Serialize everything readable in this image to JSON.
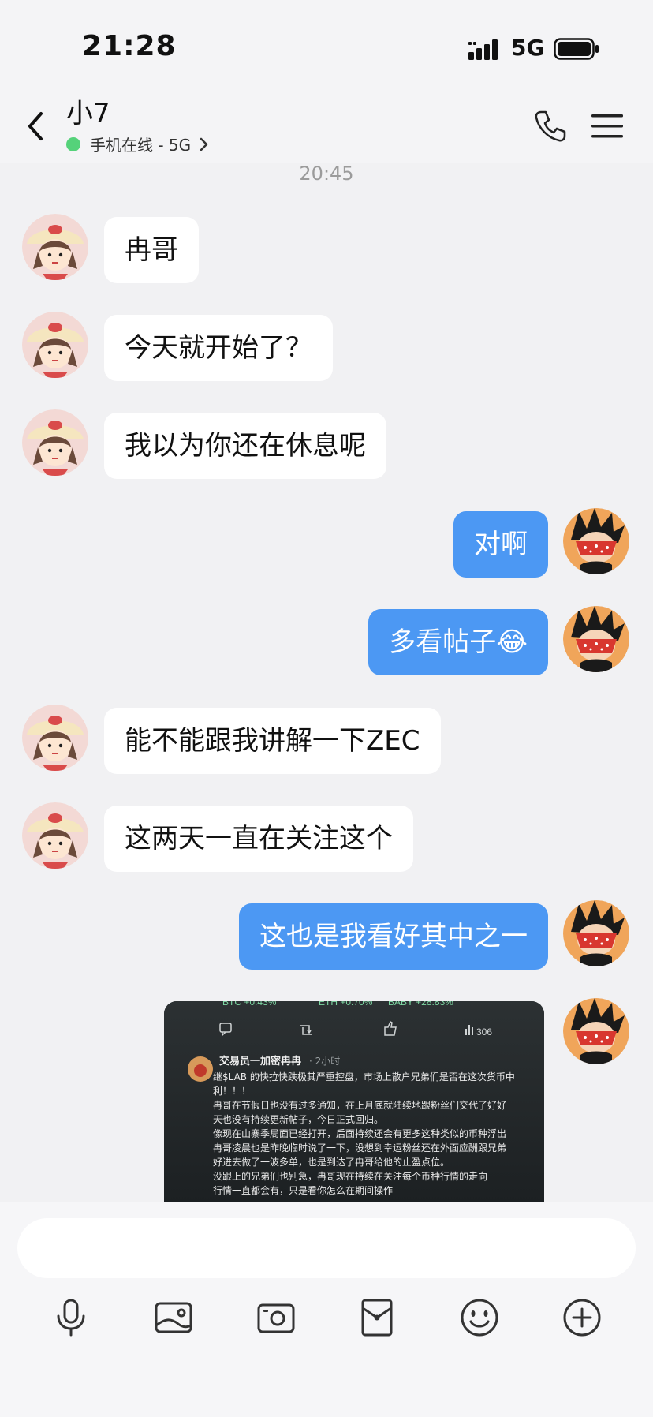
{
  "status_bar": {
    "time": "21:28",
    "network": "5G"
  },
  "header": {
    "contact_name": "小7",
    "online_status": "手机在线 - 5G"
  },
  "chat": {
    "timestamp": "20:45",
    "messages": [
      {
        "side": "in",
        "text": "冉哥"
      },
      {
        "side": "in",
        "text": "今天就开始了？"
      },
      {
        "side": "in",
        "text": "我以为你还在休息呢"
      },
      {
        "side": "out",
        "text": "对啊"
      },
      {
        "side": "out",
        "text": "多看帖子😂"
      },
      {
        "side": "in",
        "text": "能不能跟我讲解一下ZEC"
      },
      {
        "side": "in",
        "text": "这两天一直在关注这个"
      },
      {
        "side": "out",
        "text": "这也是我看好其中之一"
      },
      {
        "side": "out",
        "type": "image"
      }
    ],
    "image_post": {
      "ticker_btc": "BTC +0.43%",
      "ticker_eth": "ETH +0.70%",
      "ticker_baby": "BABY +28.83%",
      "view_count": "306",
      "author": "交易员一加密冉冉",
      "post_time": "· 2小时",
      "lines": [
        "继$LAB 的快拉快跌极其严重控盘，市场上散户兄弟们是否在这次货币中",
        "利！！！",
        "冉哥在节假日也没有过多通知，在上月底就陆续地跟粉丝们交代了好好",
        "天也没有持续更新帖子，今日正式回归。",
        "像现在山寨季局面已经打开，后面持续还会有更多这种类似的币种浮出",
        "冉哥凌晨也是昨晚临时说了一下，没想到幸运粉丝还在外面应酬跟兄弟",
        "好进去做了一波多单，也是到达了冉哥给他的止盈点位。",
        "没跟上的兄弟们也别急，冉哥现在持续在关注每个币种行情的走向",
        "行情一直都会有，只是看你怎么在期间操作"
      ]
    }
  },
  "input": {
    "placeholder": ""
  },
  "toolbar": {
    "icons": [
      "microphone-icon",
      "image-icon",
      "camera-icon",
      "red-packet-icon",
      "emoji-icon",
      "plus-icon"
    ]
  },
  "colors": {
    "outgoing_bubble": "#4c98f3",
    "incoming_bubble": "#ffffff",
    "background": "#f1f1f3",
    "online_dot": "#55d27a"
  }
}
